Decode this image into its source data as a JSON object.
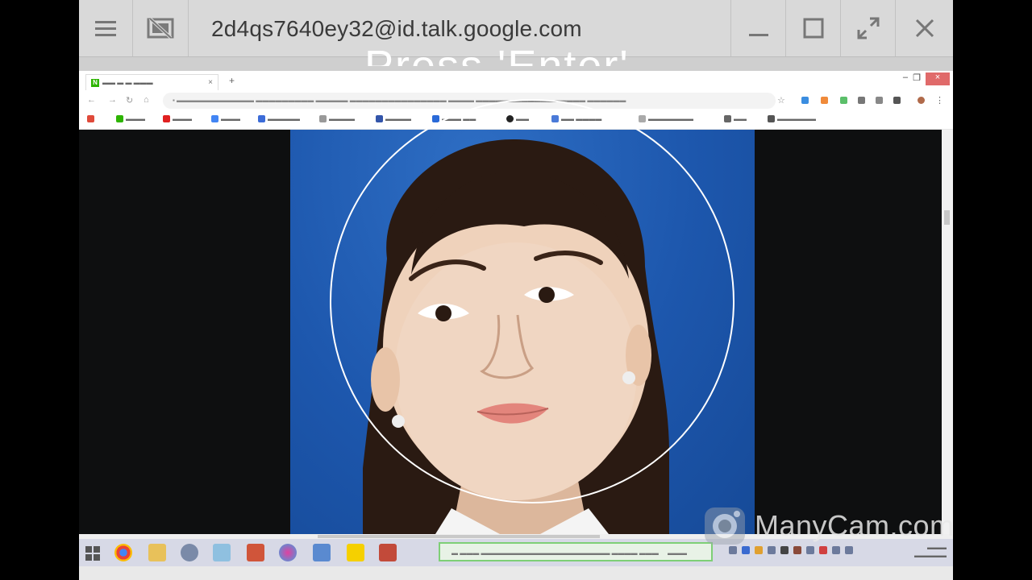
{
  "titlebar": {
    "title": "2d4qs7640ey32@id.talk.google.com",
    "icons": [
      "menu-icon",
      "screen-share-off-icon",
      "minimize-icon",
      "maximize-icon",
      "fullscreen-icon",
      "close-icon"
    ]
  },
  "overlay": {
    "prompt": "Press 'Enter'",
    "watermark": "ManyCam.com"
  },
  "colors": {
    "window_bg": "#d9d9d9",
    "photo_bg": "#1d57ad",
    "taskbar": "#d7d9e6",
    "notification_border": "#7ecf76"
  }
}
